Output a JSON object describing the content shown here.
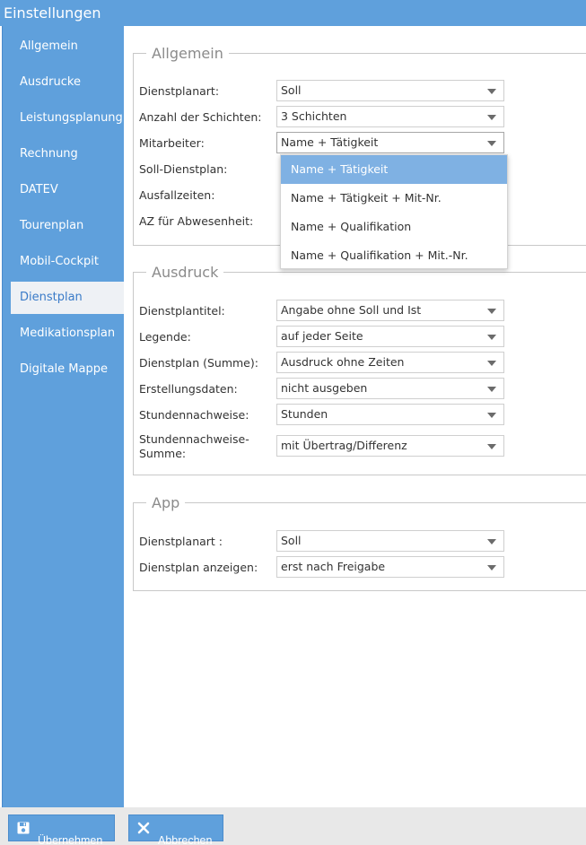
{
  "window": {
    "title": "Einstellungen"
  },
  "sidebar": {
    "items": [
      {
        "label": "Allgemein"
      },
      {
        "label": "Ausdrucke"
      },
      {
        "label": "Leistungsplanung"
      },
      {
        "label": "Rechnung"
      },
      {
        "label": "DATEV"
      },
      {
        "label": "Tourenplan"
      },
      {
        "label": "Mobil-Cockpit"
      },
      {
        "label": "Dienstplan",
        "active": true
      },
      {
        "label": "Medikationsplan"
      },
      {
        "label": "Digitale Mappe"
      }
    ]
  },
  "allgemein": {
    "legend": "Allgemein",
    "dienstplanart": {
      "label": "Dienstplanart:",
      "value": "Soll"
    },
    "schichten": {
      "label": "Anzahl der Schichten:",
      "value": "3 Schichten"
    },
    "mitarbeiter": {
      "label": "Mitarbeiter:",
      "value": "Name + Tätigkeit"
    },
    "soll_dienstplan": {
      "label": "Soll-Dienstplan:"
    },
    "ausfallzeiten": {
      "label": "Ausfallzeiten:"
    },
    "az_abwesenheit": {
      "label": "AZ für Abwesenheit:"
    }
  },
  "mitarbeiter_dropdown": {
    "options": [
      {
        "label": "Name + Tätigkeit",
        "selected": true
      },
      {
        "label": "Name + Tätigkeit + Mit-Nr."
      },
      {
        "label": "Name + Qualifikation"
      },
      {
        "label": "Name + Qualifikation + Mit.-Nr."
      }
    ]
  },
  "ausdruck": {
    "legend": "Ausdruck",
    "dienstplantitel": {
      "label": "Dienstplantitel:",
      "value": "Angabe ohne Soll und Ist"
    },
    "legende": {
      "label": "Legende:",
      "value": "auf jeder Seite"
    },
    "summe": {
      "label": "Dienstplan (Summe):",
      "value": "Ausdruck ohne Zeiten"
    },
    "erstellungsdaten": {
      "label": "Erstellungsdaten:",
      "value": "nicht ausgeben"
    },
    "stundennachweise": {
      "label": "Stundennachweise:",
      "value": "Stunden"
    },
    "stundennachweise_summe": {
      "label": "Stundennachweise-Summe:",
      "value": "mit Übertrag/Differenz"
    }
  },
  "app": {
    "legend": "App",
    "dienstplanart": {
      "label": "Dienstplanart :",
      "value": "Soll"
    },
    "anzeigen": {
      "label": "Dienstplan anzeigen:",
      "value": "erst nach Freigabe"
    }
  },
  "footer": {
    "apply_label": "Übernehmen",
    "cancel_label": "Abbrechen"
  },
  "colors": {
    "accent": "#5fa0dc",
    "dropdown_selected": "#7fb1e3",
    "sidebar_active_bg": "#eef1f5"
  },
  "icons": {
    "apply": "save-icon",
    "cancel": "close-icon",
    "select": "chevron-down-icon"
  }
}
